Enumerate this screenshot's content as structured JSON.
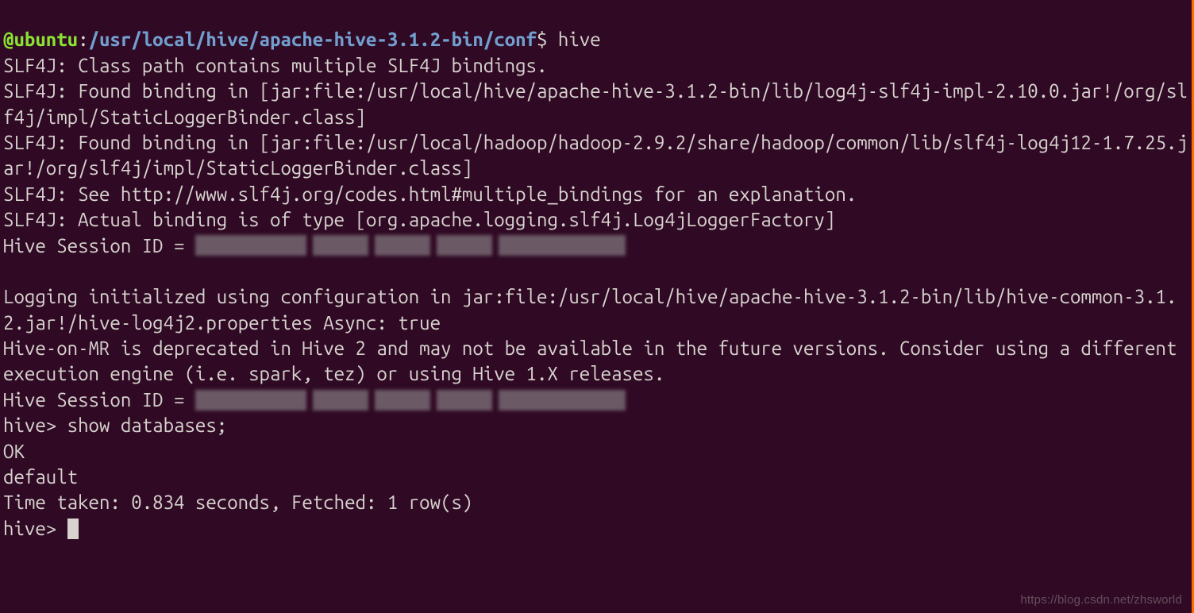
{
  "prompt1": {
    "user_host": "@ubuntu",
    "sep": ":",
    "path": "/usr/local/hive/apache-hive-3.1.2-bin/conf",
    "dollar": "$ ",
    "cmd": "hive"
  },
  "slf4j": {
    "l1": "SLF4J: Class path contains multiple SLF4J bindings.",
    "l2": "SLF4J: Found binding in [jar:file:/usr/local/hive/apache-hive-3.1.2-bin/lib/log4j-slf4j-impl-2.10.0.jar!/org/slf4j/impl/StaticLoggerBinder.class]",
    "l3": "SLF4J: Found binding in [jar:file:/usr/local/hadoop/hadoop-2.9.2/share/hadoop/common/lib/slf4j-log4j12-1.7.25.jar!/org/slf4j/impl/StaticLoggerBinder.class]",
    "l4": "SLF4J: See http://www.slf4j.org/codes.html#multiple_bindings for an explanation.",
    "l5": "SLF4J: Actual binding is of type [org.apache.logging.slf4j.Log4jLoggerFactory]"
  },
  "session1_label": "Hive Session ID = ",
  "blank": "",
  "log_init": "Logging initialized using configuration in jar:file:/usr/local/hive/apache-hive-3.1.2-bin/lib/hive-common-3.1.2.jar!/hive-log4j2.properties Async: true",
  "deprecated": "Hive-on-MR is deprecated in Hive 2 and may not be available in the future versions. Consider using a different execution engine (i.e. spark, tez) or using Hive 1.X releases.",
  "session2_label": "Hive Session ID = ",
  "hive_prompt": "hive> ",
  "hive_cmd": "show databases;",
  "ok": "OK",
  "row1": "default",
  "timing": "Time taken: 0.834 seconds, Fetched: 1 row(s)",
  "watermark": "https://blog.csdn.net/zhsworld"
}
